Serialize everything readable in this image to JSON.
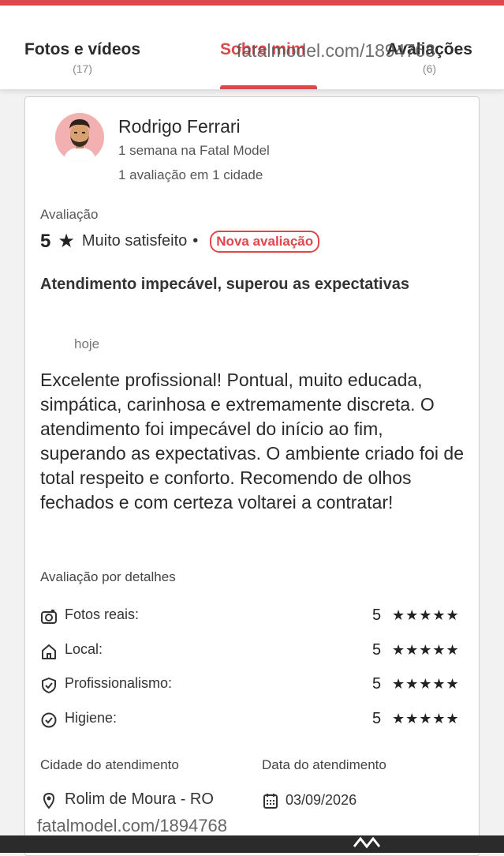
{
  "tabs": [
    {
      "label": "Fotos e vídeos",
      "count": "(17)"
    },
    {
      "label": "Sobre mim",
      "count": ""
    },
    {
      "label": "Avaliações",
      "count": "(6)"
    }
  ],
  "watermark": "fatalmodel.com/1894768",
  "reviewer": {
    "name": "Rodrigo Ferrari",
    "tenure": "1 semana na Fatal Model",
    "reviews_count": "1 avaliação em 1 cidade"
  },
  "rating": {
    "title": "Avaliação",
    "score": "5",
    "star": "★",
    "label": "Muito satisfeito",
    "separator": "•",
    "badge": "Nova avaliação"
  },
  "review": {
    "title": "Atendimento impecável, superou as expectativas",
    "date": "hoje",
    "body": "Excelente profissional! Pontual, muito educada, simpática, carinhosa e extremamente discreta. O atendimento foi impecável do início ao fim, superando as expectativas. O ambiente criado foi de total respeito e conforto. Recomendo de olhos fechados e com certeza voltarei a contratar!"
  },
  "details": {
    "title": "Avaliação por detalhes",
    "items": [
      {
        "label": "Fotos reais:",
        "value": "5",
        "stars": "★★★★★",
        "icon": "camera-icon"
      },
      {
        "label": "Local:",
        "value": "5",
        "stars": "★★★★★",
        "icon": "home-icon"
      },
      {
        "label": "Profissionalismo:",
        "value": "5",
        "stars": "★★★★★",
        "icon": "shield-check-icon"
      },
      {
        "label": "Higiene:",
        "value": "5",
        "stars": "★★★★★",
        "icon": "check-circle-icon"
      }
    ]
  },
  "footer": {
    "city_label": "Cidade do atendimento",
    "city_value": "Rolim de Moura - RO",
    "date_label": "Data do atendimento",
    "date_value": "03/09/2026"
  },
  "colors": {
    "accent": "#e0474a",
    "text": "#222222",
    "muted": "#777777"
  }
}
